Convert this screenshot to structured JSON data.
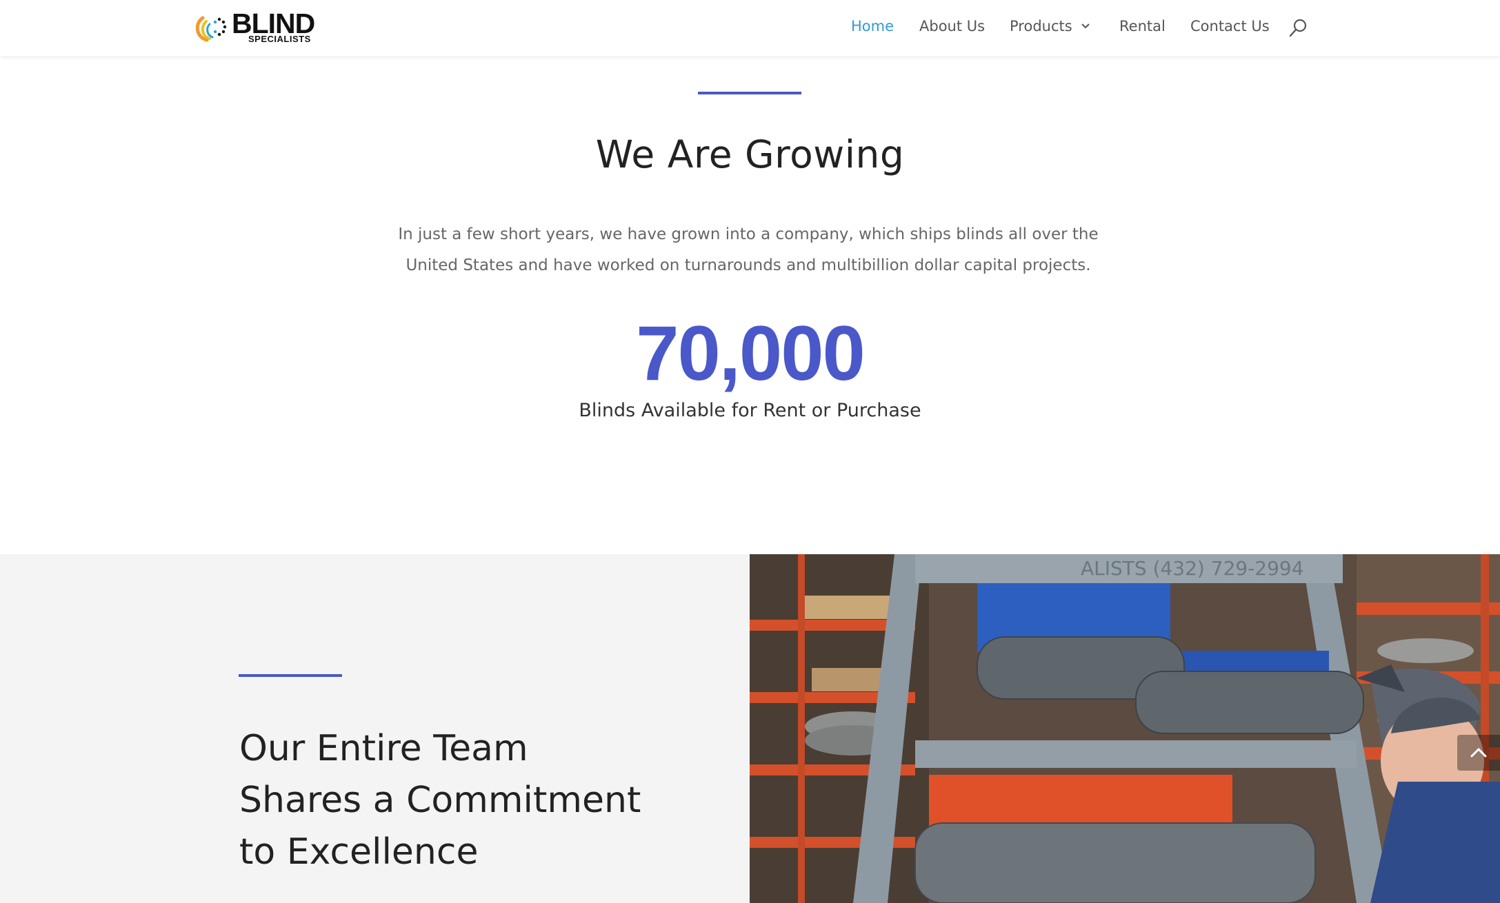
{
  "brand": {
    "name": "BLIND",
    "tagline": "SPECIALISTS"
  },
  "nav": {
    "items": [
      {
        "label": "Home",
        "active": true
      },
      {
        "label": "About Us"
      },
      {
        "label": "Products",
        "has_dropdown": true
      },
      {
        "label": "Rental"
      },
      {
        "label": "Contact Us"
      }
    ],
    "search_icon": "search-icon"
  },
  "growing": {
    "title": "We Are Growing",
    "description": "In just a few short years, we have grown into a company, which ships blinds all over the United States and have worked on turnarounds and multibillion dollar capital projects.",
    "stat_value": "70,000",
    "stat_label": "Blinds Available for Rent or Purchase"
  },
  "team": {
    "title": "Our Entire Team Shares a Commitment to Excellence"
  },
  "photo": {
    "stencil_text": "ALISTS (432) 729-2994"
  },
  "colors": {
    "accent": "#4a58c9",
    "nav_active": "#2e9bd6",
    "nav_text": "#555555"
  },
  "scroll_top_icon": "chevron-up-icon"
}
